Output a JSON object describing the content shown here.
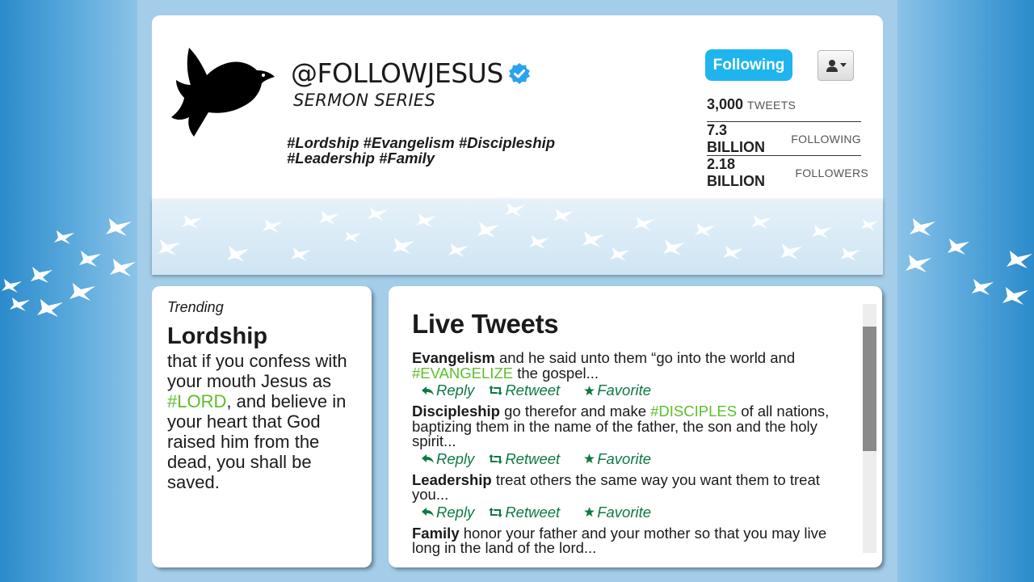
{
  "profile": {
    "handle": "@FOLLOWJESUS",
    "subtitle": "SERMON SERIES",
    "hashtags_line1": "#Lordship #Evangelism #Discipleship",
    "hashtags_line2": "#Leadership #Family",
    "follow_button_label": "Following",
    "stats": [
      {
        "number": "3,000",
        "label": "TWEETS"
      },
      {
        "number": "7.3 BILLION",
        "label": "FOLLOWING"
      },
      {
        "number": "2.18 BILLION",
        "label": "FOLLOWERS"
      }
    ]
  },
  "trending": {
    "label": "Trending",
    "title": "Lordship",
    "text_before": "that if you confess with your mouth Jesus as ",
    "highlight": "#LORD",
    "text_after": ", and believe in your heart that God raised him from the dead, you shall be saved."
  },
  "live_tweets": {
    "title": "Live Tweets",
    "actions": {
      "reply": "Reply",
      "retweet": "Retweet",
      "favorite": "Favorite"
    },
    "tweets": [
      {
        "topic": "Evangelism",
        "before": " and he said unto them “go into the world and ",
        "hashtag": "#EVANGELIZE",
        "after": " the gospel..."
      },
      {
        "topic": "Discipleship",
        "before": " go therefor and make ",
        "hashtag": "#DISCIPLES",
        "after": " of all nations, baptizing them in the name of the father, the son and the holy spirit..."
      },
      {
        "topic": "Leadership",
        "before": " treat others the same way you want them to treat you...",
        "hashtag": "",
        "after": ""
      },
      {
        "topic": "Family",
        "before": " honor your father and your mother so that you may live long in the land of the lord...",
        "hashtag": "",
        "after": ""
      }
    ]
  },
  "colors": {
    "accent_blue": "#1eb5ee",
    "hashtag_green": "#5cbf2a",
    "action_green": "#0c7a44"
  }
}
